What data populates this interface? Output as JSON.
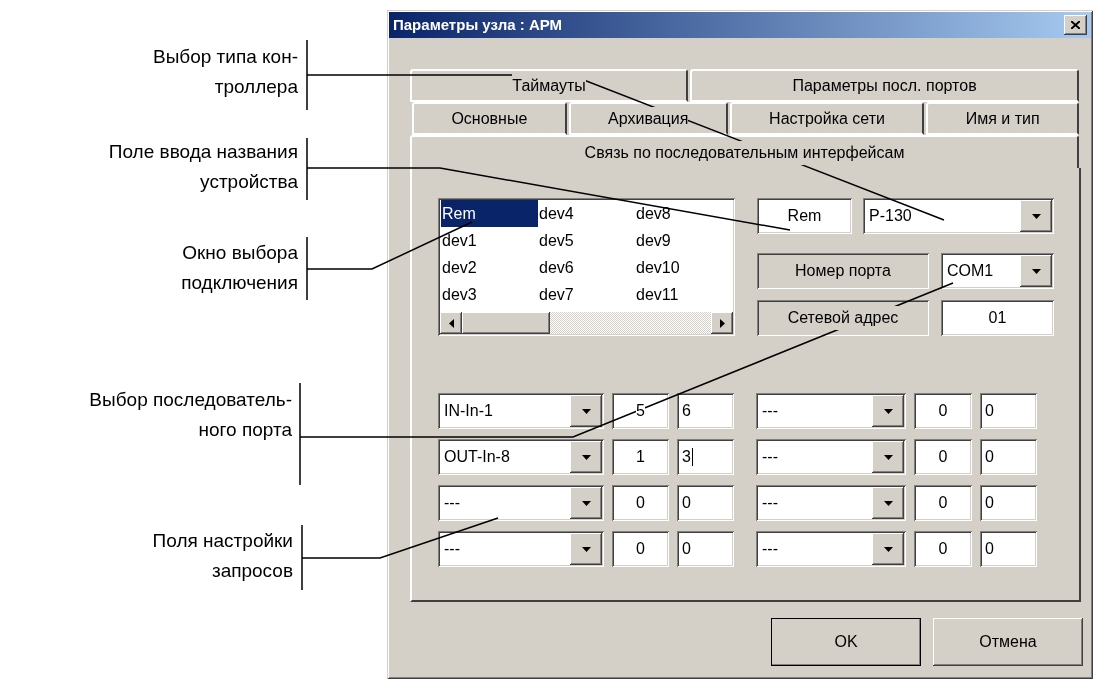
{
  "callouts": [
    {
      "lines": [
        "Выбор типа кон-",
        "троллера"
      ]
    },
    {
      "lines": [
        "Поле ввода названия",
        "устройства"
      ]
    },
    {
      "lines": [
        "Окно выбора",
        "подключения"
      ]
    },
    {
      "lines": [
        "Выбор последователь-",
        "ного порта"
      ]
    },
    {
      "lines": [
        "Поля настройки",
        "запросов"
      ]
    }
  ],
  "dialog": {
    "title": "Параметры узла : АРМ",
    "tab_rows": [
      [
        {
          "label": "Таймауты",
          "selected": false
        },
        {
          "label": "Параметры посл. портов",
          "selected": false
        }
      ],
      [
        {
          "label": "Основные",
          "selected": false
        },
        {
          "label": "Архивация",
          "selected": false
        },
        {
          "label": "Настройка сети",
          "selected": false
        },
        {
          "label": "Имя и тип",
          "selected": false
        }
      ],
      [
        {
          "label": "Связь по последовательным интерфейсам",
          "selected": true
        }
      ]
    ],
    "device_list": {
      "items": [
        {
          "text": "Rem",
          "selected": true
        },
        {
          "text": "dev1",
          "selected": false
        },
        {
          "text": "dev2",
          "selected": false
        },
        {
          "text": "dev3",
          "selected": false
        },
        {
          "text": "dev4",
          "selected": false
        },
        {
          "text": "dev5",
          "selected": false
        },
        {
          "text": "dev6",
          "selected": false
        },
        {
          "text": "dev7",
          "selected": false
        },
        {
          "text": "dev8",
          "selected": false
        },
        {
          "text": "dev9",
          "selected": false
        },
        {
          "text": "dev10",
          "selected": false
        },
        {
          "text": "dev11",
          "selected": false
        }
      ]
    },
    "device_name": "Rem",
    "controller_type": "P-130",
    "port_label": "Номер порта",
    "port": "COM1",
    "address_label": "Сетевой адрес",
    "address": "01",
    "requests": [
      {
        "cells": [
          {
            "kind": "dropdown",
            "value": "IN-In-1"
          },
          {
            "kind": "edit",
            "value": "5",
            "focused": false
          },
          {
            "kind": "edit",
            "value": "6",
            "focused": false
          },
          {
            "kind": "dropdown",
            "value": "---"
          },
          {
            "kind": "edit",
            "value": "0",
            "focused": false
          },
          {
            "kind": "edit",
            "value": "0",
            "focused": false
          }
        ]
      },
      {
        "cells": [
          {
            "kind": "dropdown",
            "value": "OUT-In-8"
          },
          {
            "kind": "edit",
            "value": "1",
            "focused": false
          },
          {
            "kind": "edit",
            "value": "3",
            "focused": true
          },
          {
            "kind": "dropdown",
            "value": "---"
          },
          {
            "kind": "edit",
            "value": "0",
            "focused": false
          },
          {
            "kind": "edit",
            "value": "0",
            "focused": false
          }
        ]
      },
      {
        "cells": [
          {
            "kind": "dropdown",
            "value": "---"
          },
          {
            "kind": "edit",
            "value": "0",
            "focused": false
          },
          {
            "kind": "edit",
            "value": "0",
            "focused": false
          },
          {
            "kind": "dropdown",
            "value": "---"
          },
          {
            "kind": "edit",
            "value": "0",
            "focused": false
          },
          {
            "kind": "edit",
            "value": "0",
            "focused": false
          }
        ]
      },
      {
        "cells": [
          {
            "kind": "dropdown",
            "value": "---"
          },
          {
            "kind": "edit",
            "value": "0",
            "focused": false
          },
          {
            "kind": "edit",
            "value": "0",
            "focused": false
          },
          {
            "kind": "dropdown",
            "value": "---"
          },
          {
            "kind": "edit",
            "value": "0",
            "focused": false
          },
          {
            "kind": "edit",
            "value": "0",
            "focused": false
          }
        ]
      }
    ],
    "buttons": [
      {
        "label": "OK",
        "default": true
      },
      {
        "label": "Отмена",
        "default": false
      }
    ]
  }
}
